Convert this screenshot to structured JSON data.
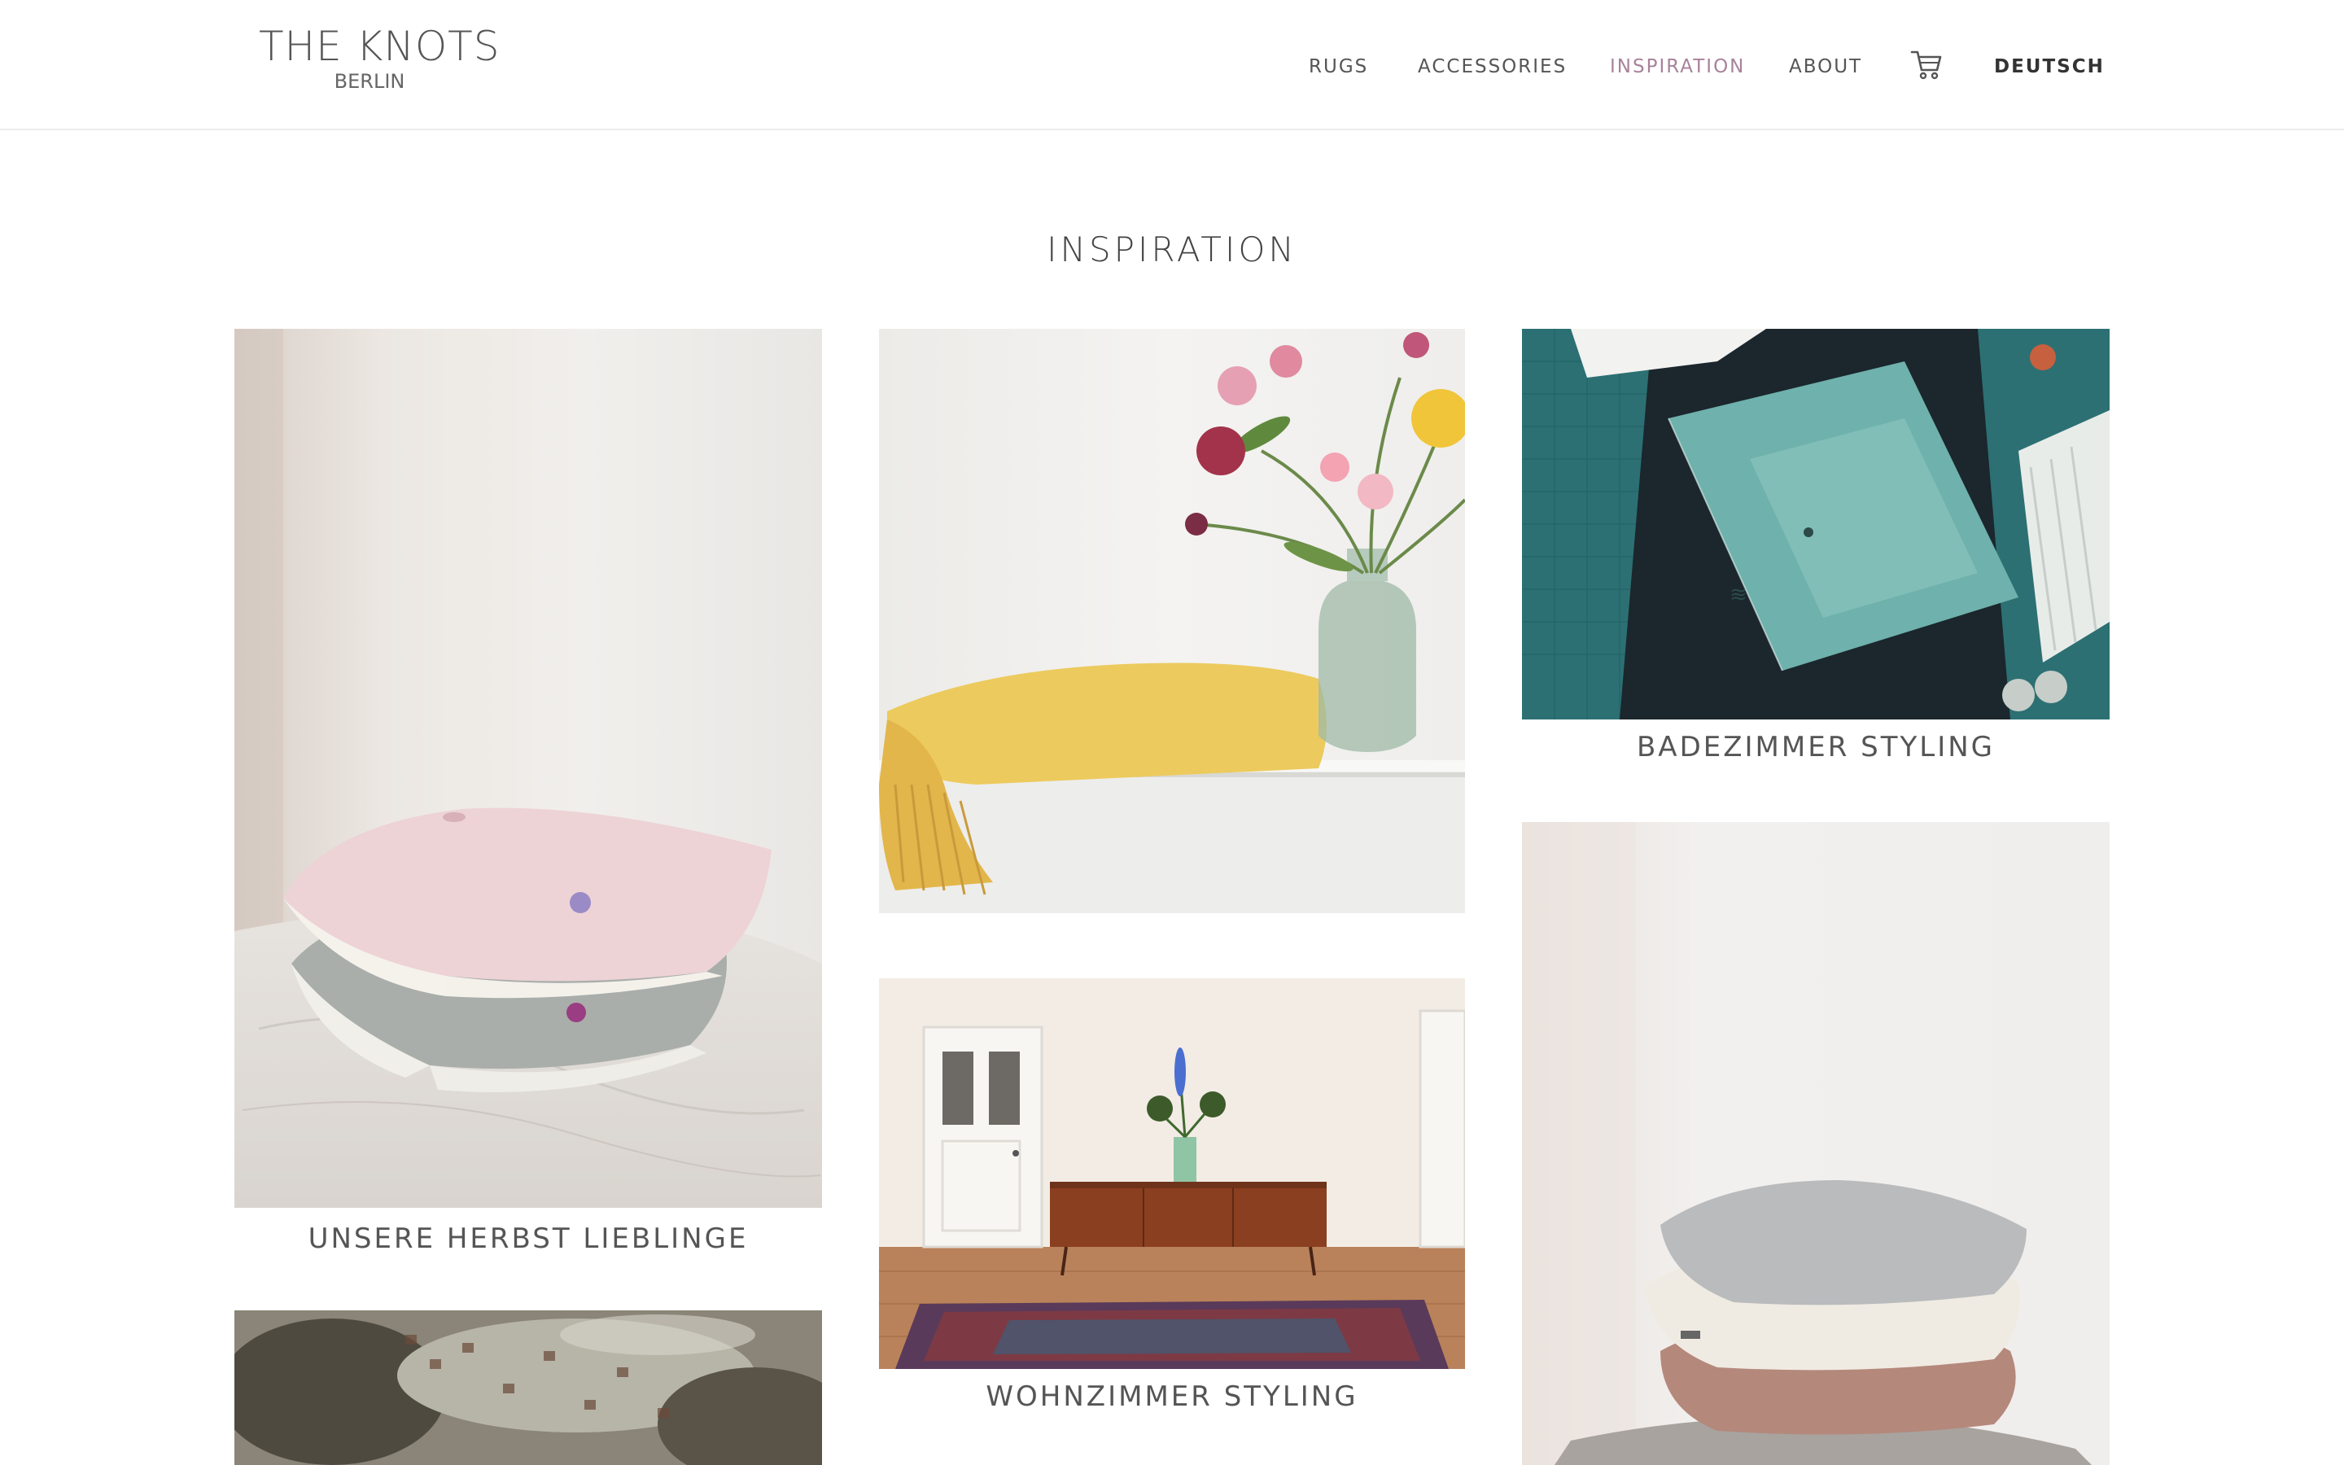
{
  "brand": {
    "title": "THE KNOTS",
    "subtitle": "BERLIN"
  },
  "nav": {
    "items": [
      {
        "label": "RUGS"
      },
      {
        "label": "ACCESSORIES"
      },
      {
        "label": "INSPIRATION",
        "active": true
      },
      {
        "label": "ABOUT"
      }
    ],
    "cart_icon": "cart-icon",
    "language": "DEUTSCH"
  },
  "colors": {
    "accent": "#a8829a",
    "text": "#555555",
    "border": "#ededed"
  },
  "page": {
    "title": "INSPIRATION"
  },
  "cards": [
    {
      "caption": "UNSERE HERBST LIEBLINGE",
      "image": "pink-grey-cushions-on-marble"
    },
    {
      "caption": "",
      "image": "yellow-blanket-with-flowers"
    },
    {
      "caption": "BADEZIMMER STYLING",
      "image": "teal-bath-mat-tiles"
    },
    {
      "caption": "WOHNZIMMER STYLING",
      "image": "sideboard-with-persian-rug"
    },
    {
      "caption": "",
      "image": "stacked-cushions"
    },
    {
      "caption": "",
      "image": "wool-texture-closeup"
    }
  ]
}
